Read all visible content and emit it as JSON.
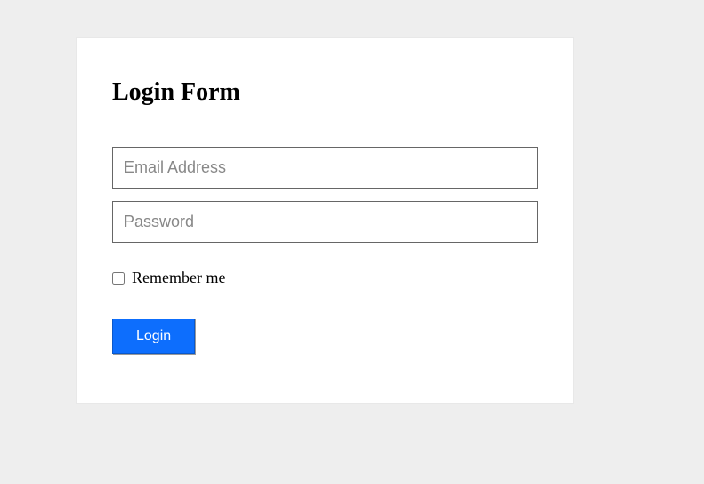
{
  "form": {
    "title": "Login Form",
    "email_placeholder": "Email Address",
    "password_placeholder": "Password",
    "remember_label": "Remember me",
    "submit_label": "Login"
  }
}
